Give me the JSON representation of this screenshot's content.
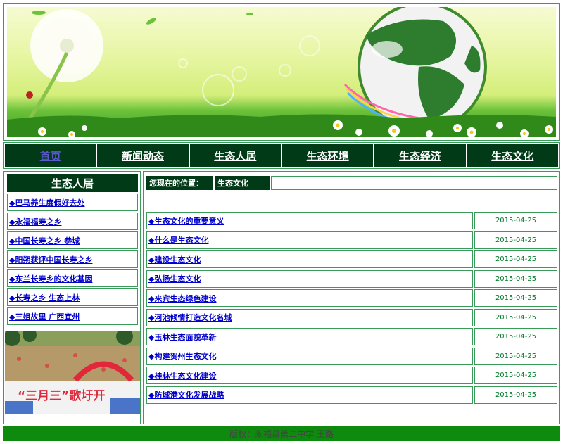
{
  "nav": [
    {
      "label": "首页"
    },
    {
      "label": "新闻动态"
    },
    {
      "label": "生态人居"
    },
    {
      "label": "生态环境"
    },
    {
      "label": "生态经济"
    },
    {
      "label": "生态文化"
    }
  ],
  "sidebar": {
    "title": "生态人居",
    "items": [
      {
        "label": "◆巴马养生度假好去处"
      },
      {
        "label": "◆永福福寿之乡"
      },
      {
        "label": "◆中国长寿之乡 恭城"
      },
      {
        "label": "◆阳朔获评中国长寿之乡"
      },
      {
        "label": "◆东兰长寿乡的文化基因"
      },
      {
        "label": "◆长寿之乡 生态上林"
      },
      {
        "label": "◆三姐故里 广西宜州"
      }
    ],
    "photo_text": "“三月三”歌圩开"
  },
  "location": {
    "label": "您现在的位置：",
    "value": "生态文化"
  },
  "articles": [
    {
      "title": "◆生态文化的重要意义",
      "date": "2015-04-25"
    },
    {
      "title": "◆什么是生态文化",
      "date": "2015-04-25"
    },
    {
      "title": "◆建设生态文化",
      "date": "2015-04-25"
    },
    {
      "title": "◆弘扬生态文化",
      "date": "2015-04-25"
    },
    {
      "title": "◆来宾生态绿色建设",
      "date": "2015-04-25"
    },
    {
      "title": "◆河池倾情打造文化名城",
      "date": "2015-04-25"
    },
    {
      "title": "◆玉林生态面貌革新",
      "date": "2015-04-25"
    },
    {
      "title": "◆构建贺州生态文化",
      "date": "2015-04-25"
    },
    {
      "title": "◆桂林生态文化建设",
      "date": "2015-04-25"
    },
    {
      "title": "◆防城港文化发展战略",
      "date": "2015-04-25"
    }
  ],
  "footer": {
    "text": "版权：永福县第二中学 王路"
  }
}
